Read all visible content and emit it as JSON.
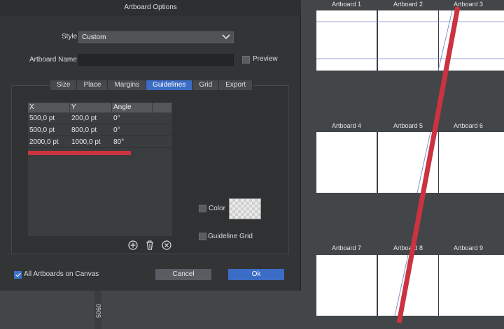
{
  "dialog": {
    "title": "Artboard Options",
    "style_label": "Style",
    "style_value": "Custom",
    "name_label": "Artboard Name",
    "name_value": "",
    "preview_label": "Preview",
    "tabs": [
      "Size",
      "Place",
      "Margins",
      "Guidelines",
      "Grid",
      "Export"
    ],
    "active_tab": "Guidelines",
    "table": {
      "headers": [
        "X",
        "Y",
        "Angle"
      ],
      "rows": [
        [
          "500,0 pt",
          "200,0 pt",
          "0°"
        ],
        [
          "500,0 pt",
          "800,0 pt",
          "0°"
        ],
        [
          "2000,0 pt",
          "1000,0 pt",
          "80°"
        ]
      ]
    },
    "color_label": "Color",
    "guideline_grid_label": "Guideline Grid",
    "all_artboards_label": "All Artboards on Canvas",
    "cancel_label": "Cancel",
    "ok_label": "Ok"
  },
  "ruler": {
    "value": "5060"
  },
  "canvas": {
    "artboards": [
      "Artboard 1",
      "Artboard 2",
      "Artboard 3",
      "Artboard 4",
      "Artboard 5",
      "Artboard 6",
      "Artboard 7",
      "Artboard 8",
      "Artboard 9"
    ]
  },
  "colors": {
    "accent": "#3b6cc6",
    "annotation": "#cc3340",
    "canvas": "#434648",
    "dialog": "#323436",
    "guide": "#7b86c8"
  },
  "icons": [
    "chevron-down-icon",
    "add-icon",
    "trash-icon",
    "remove-icon",
    "checkmark-icon"
  ]
}
